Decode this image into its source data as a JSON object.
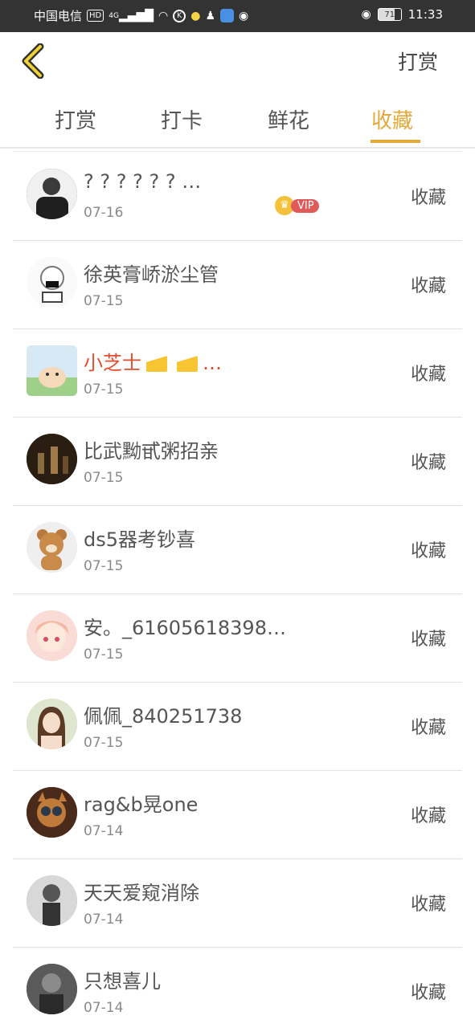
{
  "status_bar": {
    "carrier": "中国电信",
    "hd": "HD",
    "signal": "4G",
    "k_badge": "K",
    "battery": "71",
    "time": "11:33"
  },
  "header": {
    "title": "打赏"
  },
  "tabs": [
    {
      "label": "打赏",
      "active": false
    },
    {
      "label": "打卡",
      "active": false
    },
    {
      "label": "鲜花",
      "active": false
    },
    {
      "label": "收藏",
      "active": true
    }
  ],
  "colors": {
    "accent": "#e4a93a",
    "vip_name": "#e44c2e",
    "status_bar": "#333333"
  },
  "list": [
    {
      "name": "? ? ? ? ? ? …",
      "date": "07-16",
      "action": "收藏",
      "avatar_color": "#2b2b2b"
    },
    {
      "name": "徐英膏峤淤尘管",
      "date": "07-15",
      "action": "收藏",
      "avatar_color": "#f2f2f2"
    },
    {
      "name": "小芝士",
      "name_suffix": "…",
      "date": "07-15",
      "action": "收藏",
      "vip": "VIP",
      "avatar_color": "#cfe3f3"
    },
    {
      "name": "比武黝甙粥招亲",
      "date": "07-15",
      "action": "收藏",
      "avatar_color": "#3a2c1c"
    },
    {
      "name": "ds5器考钞喜",
      "date": "07-15",
      "action": "收藏",
      "avatar_color": "#c98a4a"
    },
    {
      "name": "安。_61605618398…",
      "date": "07-15",
      "action": "收藏",
      "avatar_color": "#f4c6c0"
    },
    {
      "name": "佩佩_840251738",
      "date": "07-15",
      "action": "收藏",
      "avatar_color": "#e7c6b0"
    },
    {
      "name": "rag&b晃one",
      "date": "07-14",
      "action": "收藏",
      "avatar_color": "#7a4a2a"
    },
    {
      "name": "天天爱窥消除",
      "date": "07-14",
      "action": "收藏",
      "avatar_color": "#9a9a9a"
    },
    {
      "name": "只想喜儿",
      "date": "07-14",
      "action": "收藏",
      "avatar_color": "#4a4a4a"
    }
  ]
}
